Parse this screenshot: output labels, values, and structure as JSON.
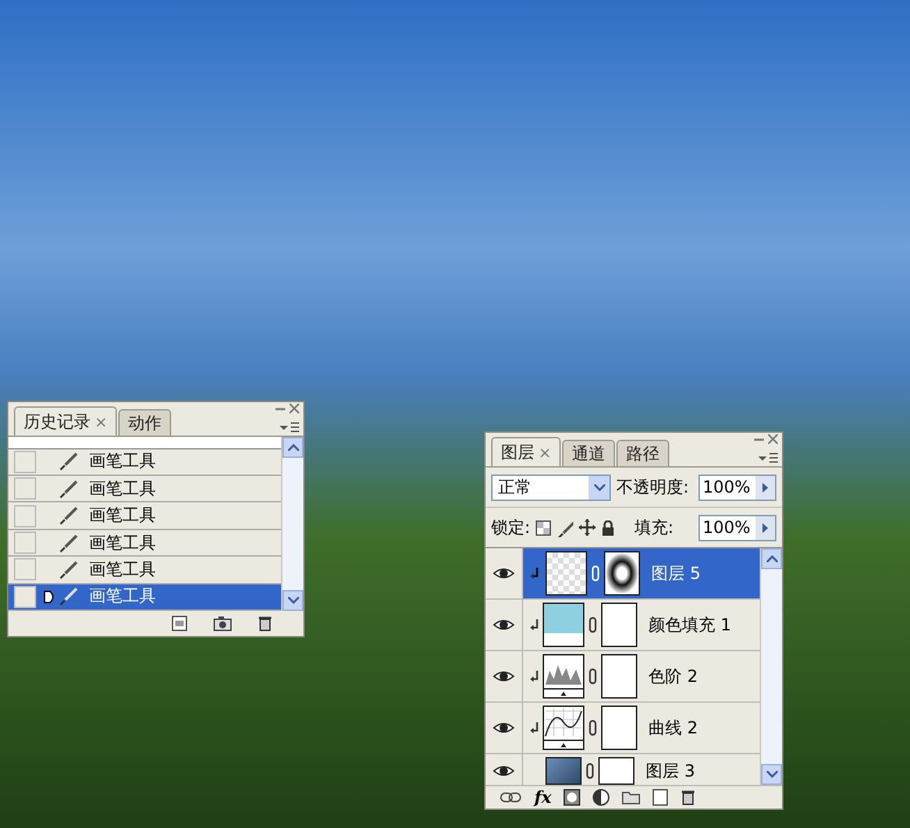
{
  "history_panel": {
    "tabs": [
      {
        "label": "历史记录",
        "close": "×",
        "selected": true
      },
      {
        "label": "动作",
        "selected": false
      }
    ],
    "items": [
      {
        "label": "画笔工具",
        "selected": false
      },
      {
        "label": "画笔工具",
        "selected": false
      },
      {
        "label": "画笔工具",
        "selected": false
      },
      {
        "label": "画笔工具",
        "selected": false
      },
      {
        "label": "画笔工具",
        "selected": false
      },
      {
        "label": "画笔工具",
        "selected": true
      }
    ]
  },
  "layers_panel": {
    "tabs": [
      {
        "label": "图层",
        "close": "×",
        "selected": true
      },
      {
        "label": "通道",
        "selected": false
      },
      {
        "label": "路径",
        "selected": false
      }
    ],
    "blend_mode": "正常",
    "opacity_label": "不透明度:",
    "opacity": "100%",
    "lock_label": "锁定:",
    "fill_label": "填充:",
    "fill": "100%",
    "layers": [
      {
        "name": "图层 5",
        "kind": "pixel",
        "visible": true,
        "clipped": true,
        "selected": true
      },
      {
        "name": "颜色填充 1",
        "kind": "solid-fill",
        "visible": true,
        "clipped": true,
        "selected": false
      },
      {
        "name": "色阶 2",
        "kind": "levels",
        "visible": true,
        "clipped": true,
        "selected": false
      },
      {
        "name": "曲线 2",
        "kind": "curves",
        "visible": true,
        "clipped": true,
        "selected": false
      },
      {
        "name": "图层 3",
        "kind": "photo",
        "visible": true,
        "clipped": false,
        "selected": false
      }
    ],
    "fx_label": "fx"
  }
}
